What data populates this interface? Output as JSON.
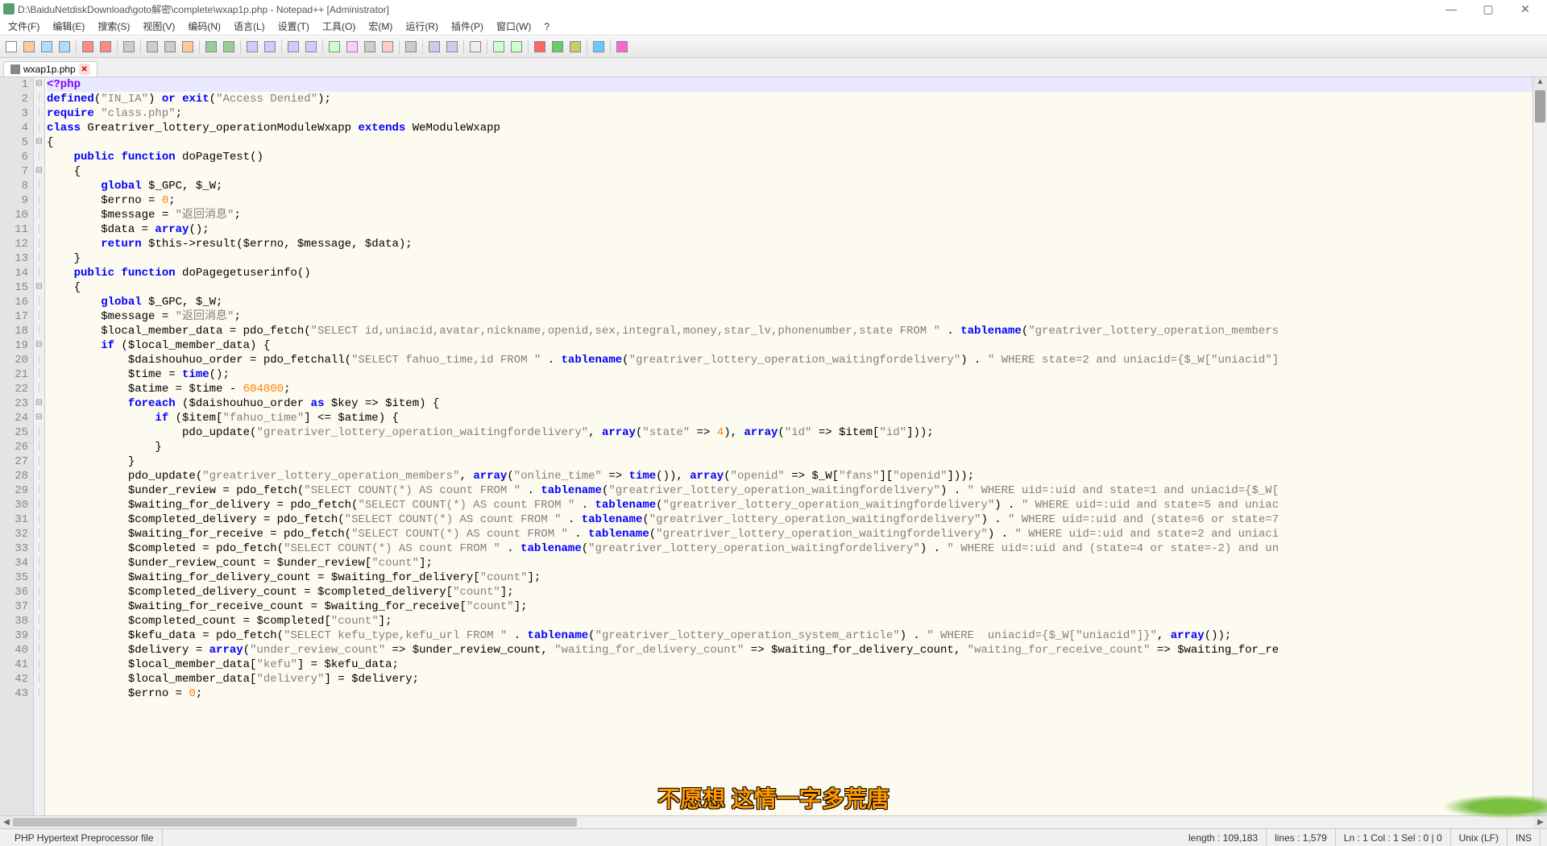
{
  "window": {
    "title": "D:\\BaiduNetdiskDownload\\goto解密\\complete\\wxap1p.php - Notepad++ [Administrator]"
  },
  "menu": {
    "file": "文件(F)",
    "edit": "编辑(E)",
    "search": "搜索(S)",
    "view": "视图(V)",
    "encoding": "编码(N)",
    "language": "语言(L)",
    "settings": "设置(T)",
    "tools": "工具(O)",
    "macro": "宏(M)",
    "run": "运行(R)",
    "plugins": "插件(P)",
    "window": "窗口(W)",
    "help": "?"
  },
  "tab": {
    "filename": "wxap1p.php"
  },
  "status": {
    "filetype": "PHP Hypertext Preprocessor file",
    "length": "length : 109,183",
    "lines": "lines : 1,579",
    "pos": "Ln : 1    Col : 1    Sel : 0 | 0",
    "eol": "Unix (LF)",
    "ins": "INS"
  },
  "caption": "不愿想 这情一字多荒唐",
  "lines": [
    1,
    2,
    3,
    4,
    5,
    6,
    7,
    8,
    9,
    10,
    11,
    12,
    13,
    14,
    15,
    16,
    17,
    18,
    19,
    20,
    21,
    22,
    23,
    24,
    25,
    26,
    27,
    28,
    29,
    30,
    31,
    32,
    33,
    34,
    35,
    36,
    37,
    38,
    39,
    40,
    41,
    42,
    43
  ],
  "code_html": [
    "<span class='op'>&lt;?php</span>",
    "<span class='kw'>defined</span>(<span class='str'>\"IN_IA\"</span>) <span class='kw'>or</span> <span class='kw'>exit</span>(<span class='str'>\"Access Denied\"</span>);",
    "<span class='kw'>require</span> <span class='str'>\"class.php\"</span>;",
    "<span class='kw'>class</span> Greatriver_lottery_operationModuleWxapp <span class='kw'>extends</span> WeModuleWxapp",
    "{",
    "    <span class='kw'>public</span> <span class='kw'>function</span> doPageTest()",
    "    {",
    "        <span class='kw'>global</span> $_GPC, $_W;",
    "        $errno = <span class='num'>0</span>;",
    "        $message = <span class='str'>\"返回消息\"</span>;",
    "        $data = <span class='kw'>array</span>();",
    "        <span class='kw'>return</span> $this-&gt;result($errno, $message, $data);",
    "    }",
    "    <span class='kw'>public</span> <span class='kw'>function</span> doPagegetuserinfo()",
    "    {",
    "        <span class='kw'>global</span> $_GPC, $_W;",
    "        $message = <span class='str'>\"返回消息\"</span>;",
    "        $local_member_data = pdo_fetch(<span class='str'>\"SELECT id,uniacid,avatar,nickname,openid,sex,integral,money,star_lv,phonenumber,state FROM \"</span> . <span class='kw'>tablename</span>(<span class='str'>\"greatriver_lottery_operation_members</span>",
    "        <span class='kw'>if</span> ($local_member_data) {",
    "            $daishouhuo_order = pdo_fetchall(<span class='str'>\"SELECT fahuo_time,id FROM \"</span> . <span class='kw'>tablename</span>(<span class='str'>\"greatriver_lottery_operation_waitingfordelivery\"</span>) . <span class='str'>\" WHERE state=2 and uniacid={$_W[\"uniacid\"]</span>",
    "            $time = <span class='kw'>time</span>();",
    "            $atime = $time - <span class='num'>604800</span>;",
    "            <span class='kw'>foreach</span> ($daishouhuo_order <span class='kw'>as</span> $key =&gt; $item) {",
    "                <span class='kw'>if</span> ($item[<span class='str'>\"fahuo_time\"</span>] &lt;= $atime) {",
    "                    pdo_update(<span class='str'>\"greatriver_lottery_operation_waitingfordelivery\"</span>, <span class='kw'>array</span>(<span class='str'>\"state\"</span> =&gt; <span class='num'>4</span>), <span class='kw'>array</span>(<span class='str'>\"id\"</span> =&gt; $item[<span class='str'>\"id\"</span>]));",
    "                }",
    "            }",
    "            pdo_update(<span class='str'>\"greatriver_lottery_operation_members\"</span>, <span class='kw'>array</span>(<span class='str'>\"online_time\"</span> =&gt; <span class='kw'>time</span>()), <span class='kw'>array</span>(<span class='str'>\"openid\"</span> =&gt; $_W[<span class='str'>\"fans\"</span>][<span class='str'>\"openid\"</span>]));",
    "            $under_review = pdo_fetch(<span class='str'>\"SELECT COUNT(*) AS count FROM \"</span> . <span class='kw'>tablename</span>(<span class='str'>\"greatriver_lottery_operation_waitingfordelivery\"</span>) . <span class='str'>\" WHERE uid=:uid and state=1 and uniacid={$_W[</span>",
    "            $waiting_for_delivery = pdo_fetch(<span class='str'>\"SELECT COUNT(*) AS count FROM \"</span> . <span class='kw'>tablename</span>(<span class='str'>\"greatriver_lottery_operation_waitingfordelivery\"</span>) . <span class='str'>\" WHERE uid=:uid and state=5 and uniac</span>",
    "            $completed_delivery = pdo_fetch(<span class='str'>\"SELECT COUNT(*) AS count FROM \"</span> . <span class='kw'>tablename</span>(<span class='str'>\"greatriver_lottery_operation_waitingfordelivery\"</span>) . <span class='str'>\" WHERE uid=:uid and (state=6 or state=7</span>",
    "            $waiting_for_receive = pdo_fetch(<span class='str'>\"SELECT COUNT(*) AS count FROM \"</span> . <span class='kw'>tablename</span>(<span class='str'>\"greatriver_lottery_operation_waitingfordelivery\"</span>) . <span class='str'>\" WHERE uid=:uid and state=2 and uniaci</span>",
    "            $completed = pdo_fetch(<span class='str'>\"SELECT COUNT(*) AS count FROM \"</span> . <span class='kw'>tablename</span>(<span class='str'>\"greatriver_lottery_operation_waitingfordelivery\"</span>) . <span class='str'>\" WHERE uid=:uid and (state=4 or state=-2) and un</span>",
    "            $under_review_count = $under_review[<span class='str'>\"count\"</span>];",
    "            $waiting_for_delivery_count = $waiting_for_delivery[<span class='str'>\"count\"</span>];",
    "            $completed_delivery_count = $completed_delivery[<span class='str'>\"count\"</span>];",
    "            $waiting_for_receive_count = $waiting_for_receive[<span class='str'>\"count\"</span>];",
    "            $completed_count = $completed[<span class='str'>\"count\"</span>];",
    "            $kefu_data = pdo_fetch(<span class='str'>\"SELECT kefu_type,kefu_url FROM \"</span> . <span class='kw'>tablename</span>(<span class='str'>\"greatriver_lottery_operation_system_article\"</span>) . <span class='str'>\" WHERE  uniacid={$_W[\"uniacid\"]}\"</span>, <span class='kw'>array</span>());",
    "            $delivery = <span class='kw'>array</span>(<span class='str'>\"under_review_count\"</span> =&gt; $under_review_count, <span class='str'>\"waiting_for_delivery_count\"</span> =&gt; $waiting_for_delivery_count, <span class='str'>\"waiting_for_receive_count\"</span> =&gt; $waiting_for_re",
    "            $local_member_data[<span class='str'>\"kefu\"</span>] = $kefu_data;",
    "            $local_member_data[<span class='str'>\"delivery\"</span>] = $delivery;",
    "            $errno = <span class='num'>0</span>;"
  ],
  "fold": [
    "minus",
    "line",
    "line",
    "line",
    "minus",
    "line",
    "minus",
    "line",
    "line",
    "line",
    "line",
    "line",
    "line",
    "line",
    "minus",
    "line",
    "line",
    "line",
    "minus",
    "line",
    "line",
    "line",
    "minus",
    "minus",
    "line",
    "line",
    "line",
    "line",
    "line",
    "line",
    "line",
    "line",
    "line",
    "line",
    "line",
    "line",
    "line",
    "line",
    "line",
    "line",
    "line",
    "line",
    "line"
  ],
  "toolbar_icons": [
    "new",
    "open",
    "save",
    "saveall",
    "sep",
    "close",
    "closeall",
    "sep",
    "print",
    "sep",
    "cut",
    "copy",
    "paste",
    "sep",
    "undo",
    "redo",
    "sep",
    "find",
    "replace",
    "sep",
    "zoomin",
    "zoomout",
    "sep",
    "sync",
    "wrap",
    "guides",
    "lang",
    "sep",
    "indent",
    "sep",
    "fold",
    "unfold",
    "sep",
    "hide",
    "sep",
    "comment",
    "uncomment",
    "sep",
    "rec",
    "play",
    "stop",
    "sep",
    "run",
    "sep",
    "spell"
  ]
}
